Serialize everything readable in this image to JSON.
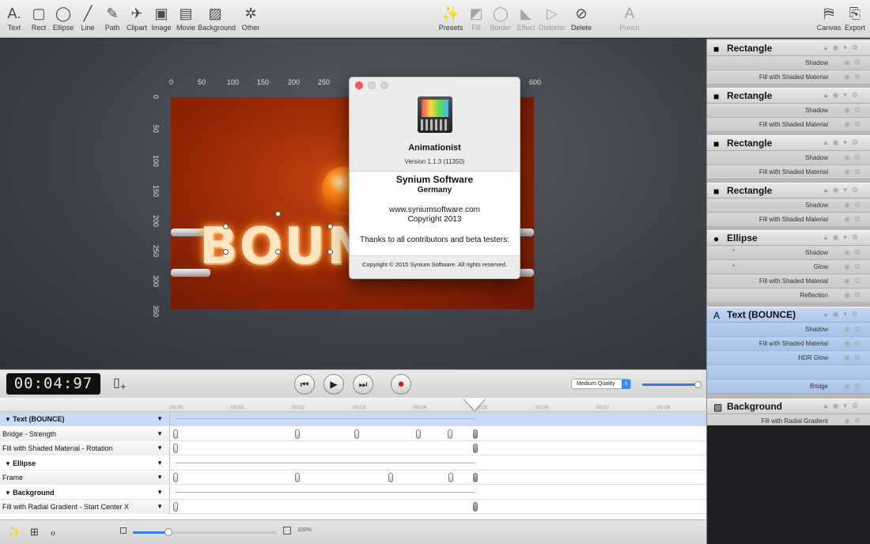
{
  "toolbar": {
    "left": [
      {
        "label": "Text",
        "icon": "text-icon",
        "glyph": "A."
      },
      {
        "label": "Rect",
        "icon": "rect-icon",
        "glyph": "▢"
      },
      {
        "label": "Ellipse",
        "icon": "ellipse-icon",
        "glyph": "◯"
      },
      {
        "label": "Line",
        "icon": "line-icon",
        "glyph": "╱"
      },
      {
        "label": "Path",
        "icon": "path-icon",
        "glyph": "✎"
      },
      {
        "label": "Clipart",
        "icon": "clipart-icon",
        "glyph": "✈"
      },
      {
        "label": "Image",
        "icon": "image-icon",
        "glyph": "▣"
      },
      {
        "label": "Movie",
        "icon": "movie-icon",
        "glyph": "▤"
      },
      {
        "label": "Background",
        "icon": "background-icon",
        "glyph": "▨"
      },
      {
        "label": "Other",
        "icon": "other-icon",
        "glyph": "✲"
      }
    ],
    "middle": [
      {
        "label": "Presets",
        "icon": "presets-wand-icon",
        "glyph": "✨",
        "enabled": true
      },
      {
        "label": "Fill",
        "icon": "fill-icon",
        "glyph": "◩",
        "enabled": false
      },
      {
        "label": "Border",
        "icon": "border-icon",
        "glyph": "◯",
        "enabled": false
      },
      {
        "label": "Effect",
        "icon": "effect-icon",
        "glyph": "◣",
        "enabled": false
      },
      {
        "label": "Distorter",
        "icon": "distorter-icon",
        "glyph": "▷",
        "enabled": false
      },
      {
        "label": "Delete",
        "icon": "delete-icon",
        "glyph": "⊘",
        "enabled": true
      }
    ],
    "punch": {
      "label": "Punch",
      "icon": "punch-icon",
      "glyph": "Ａ"
    },
    "right": [
      {
        "label": "Canvas",
        "icon": "canvas-icon",
        "glyph": "⛿"
      },
      {
        "label": "Export",
        "icon": "export-icon",
        "glyph": "⎘"
      }
    ]
  },
  "rulers": {
    "top": [
      "0",
      "50",
      "100",
      "150",
      "200",
      "250",
      "600"
    ],
    "left": [
      "0",
      "50",
      "100",
      "150",
      "200",
      "250",
      "300",
      "350"
    ]
  },
  "canvas": {
    "text": "BOUNCE"
  },
  "about": {
    "app_name": "Animationist",
    "version": "Version 1.1.3 (11350)",
    "company": "Synium Software",
    "country": "Germany",
    "website": "www.syniumsoftware.com",
    "copyright": "Copyright 2013",
    "thanks": "Thanks to all contributors and beta testers:",
    "footer": "Copyright © 2015 Synium Software. All rights reserved."
  },
  "transport": {
    "timecode": "00:04:97",
    "quality": "Medium Quality",
    "quality_level": 1.0
  },
  "timeline": {
    "ticks": [
      "00:00",
      "00:01",
      "00:02",
      "00:03",
      "00:04",
      "00:05",
      "00:06",
      "00:07",
      "00:08"
    ],
    "rows": [
      {
        "label": "Text (BOUNCE)",
        "type": "group",
        "selected": true
      },
      {
        "label": "Bridge - Strength",
        "type": "param"
      },
      {
        "label": "Fill with Shaded Material - Rotation",
        "type": "param"
      },
      {
        "label": "Ellipse",
        "type": "group"
      },
      {
        "label": "Frame",
        "type": "param"
      },
      {
        "label": "Background",
        "type": "group"
      },
      {
        "label": "Fill with Radial Gradient - Start Center X",
        "type": "param"
      }
    ]
  },
  "bottombar": {
    "zoom": "100%"
  },
  "inspector": {
    "layers": [
      {
        "name": "Rectangle",
        "icon": "square-icon",
        "glyph": "■",
        "items": [
          "Shadow",
          "Fill with Shaded Material"
        ]
      },
      {
        "name": "Rectangle",
        "icon": "square-icon",
        "glyph": "■",
        "items": [
          "Shadow",
          "Fill with Shaded Material"
        ]
      },
      {
        "name": "Rectangle",
        "icon": "square-icon",
        "glyph": "■",
        "items": [
          "Shadow",
          "Fill with Shaded Material"
        ]
      },
      {
        "name": "Rectangle",
        "icon": "square-icon",
        "glyph": "■",
        "items": [
          "Shadow",
          "Fill with Shaded Material"
        ]
      },
      {
        "name": "Ellipse",
        "icon": "circle-icon",
        "glyph": "●",
        "items": [
          "Shadow",
          "Glow",
          "Fill with Shaded Material",
          "Reflection"
        ]
      },
      {
        "name": "Text (BOUNCE)",
        "icon": "text-icon",
        "glyph": "A",
        "selected": true,
        "items": [
          "Shadow",
          "Fill with Shaded Material",
          "HDR Glow",
          "",
          "Bridge"
        ]
      },
      {
        "name": "Background",
        "icon": "background-icon",
        "glyph": "▨",
        "items": [
          "Fill with Radial Gradient"
        ]
      }
    ]
  }
}
